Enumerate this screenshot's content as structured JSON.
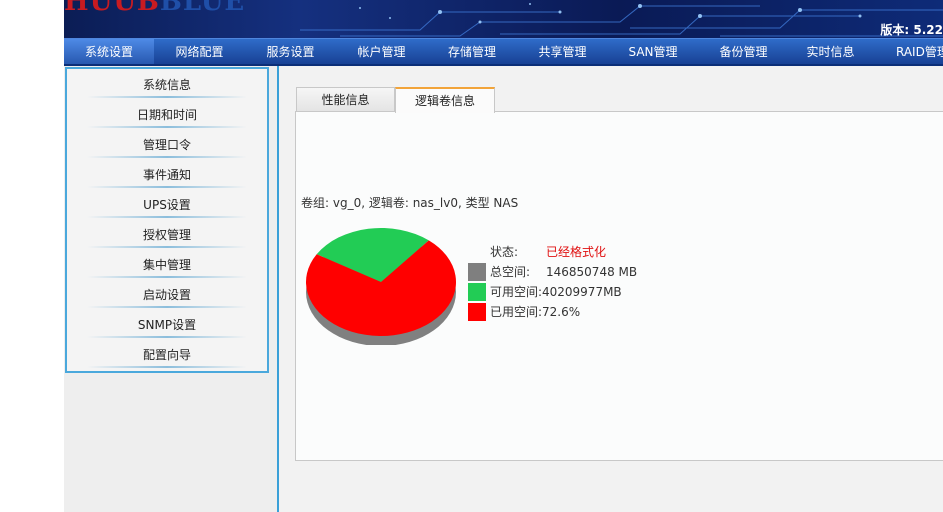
{
  "header": {
    "logo_text_a": "HUUB",
    "logo_text_b": "BLUE",
    "version": "版本: 5.22"
  },
  "nav": {
    "items": [
      {
        "label": "系统设置",
        "active": true
      },
      {
        "label": "网络配置"
      },
      {
        "label": "服务设置"
      },
      {
        "label": "帐户管理"
      },
      {
        "label": "存储管理"
      },
      {
        "label": "共享管理"
      },
      {
        "label": "SAN管理"
      },
      {
        "label": "备份管理"
      },
      {
        "label": "实时信息"
      },
      {
        "label": "RAID管理"
      }
    ]
  },
  "sidebar": {
    "items": [
      {
        "label": "系统信息"
      },
      {
        "label": "日期和时间"
      },
      {
        "label": "管理口令"
      },
      {
        "label": "事件通知"
      },
      {
        "label": "UPS设置"
      },
      {
        "label": "授权管理"
      },
      {
        "label": "集中管理"
      },
      {
        "label": "启动设置"
      },
      {
        "label": "SNMP设置"
      },
      {
        "label": "配置向导"
      }
    ]
  },
  "tabs": [
    {
      "label": "性能信息"
    },
    {
      "label": "逻辑卷信息",
      "active": true
    }
  ],
  "volume": {
    "info": "卷组: vg_0, 逻辑卷: nas_lv0, 类型 NAS",
    "status_label": "状态:",
    "status_value": "已经格式化",
    "status_color": "#e01010",
    "total_label": "总空间:",
    "total_value": "146850748 MB",
    "free_label": "可用空间:",
    "free_value": "40209977MB",
    "used_label": "已用空间:",
    "used_value": "72.6%"
  },
  "chart_data": {
    "type": "pie",
    "slices": [
      {
        "name": "已用空间",
        "value": 72.6,
        "color": "#ff0000"
      },
      {
        "name": "可用空间",
        "value": 27.4,
        "color": "#22cc55"
      }
    ],
    "colors": {
      "total": "#7f7f7f",
      "free": "#22cc55",
      "used": "#ff0000"
    }
  }
}
